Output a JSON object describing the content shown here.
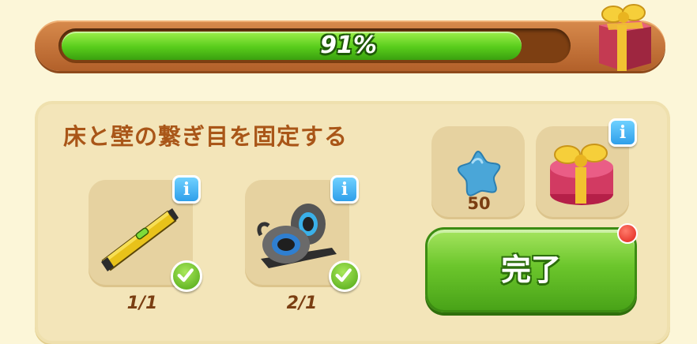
{
  "progress": {
    "percent": 91,
    "label": "91%"
  },
  "task": {
    "title": "床と壁の繋ぎ目を固定する",
    "requirements": [
      {
        "item": "level-tool",
        "count": "1/1",
        "completed": true
      },
      {
        "item": "duct-tape",
        "count": "2/1",
        "completed": true
      }
    ]
  },
  "rewards": [
    {
      "item": "star",
      "count": "50"
    },
    {
      "item": "gift-box",
      "count": ""
    }
  ],
  "complete_button": {
    "label": "完了"
  },
  "colors": {
    "accent_green": "#6cc62c",
    "title_brown": "#a95618",
    "info_blue": "#2f9fea"
  }
}
